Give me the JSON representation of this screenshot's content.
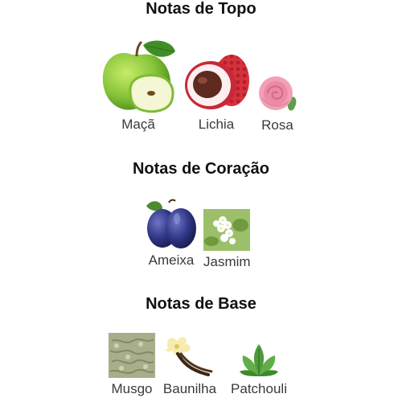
{
  "sections": [
    {
      "title": "Notas de Topo",
      "notes": [
        {
          "label": "Maçã",
          "icon": "green-apple"
        },
        {
          "label": "Lichia",
          "icon": "lychee"
        },
        {
          "label": "Rosa",
          "icon": "pink-rose"
        }
      ]
    },
    {
      "title": "Notas de Coração",
      "notes": [
        {
          "label": "Ameixa",
          "icon": "plums"
        },
        {
          "label": "Jasmim",
          "icon": "jasmine-flower"
        }
      ]
    },
    {
      "title": "Notas de Base",
      "notes": [
        {
          "label": "Musgo",
          "icon": "moss"
        },
        {
          "label": "Baunilha",
          "icon": "vanilla-flower-and-pods"
        },
        {
          "label": "Patchouli",
          "icon": "patchouli-leaves"
        }
      ]
    }
  ]
}
